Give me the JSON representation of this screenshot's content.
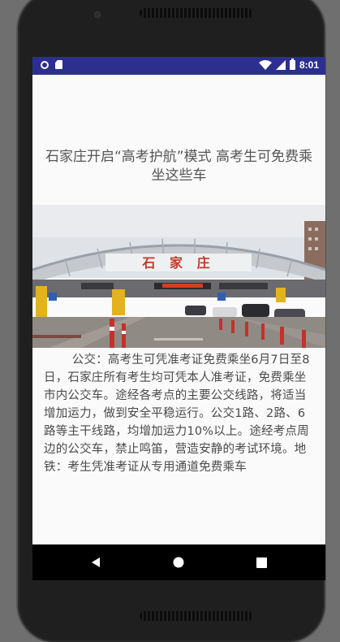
{
  "status_bar": {
    "time": "8:01",
    "icons": [
      "ring-icon",
      "sd-card-icon",
      "wifi-icon",
      "signal-icon",
      "battery-icon"
    ]
  },
  "article": {
    "title": "石家庄开启“高考护航”模式 高考生可免费乘坐这些车",
    "image": {
      "icon": "toll-gate-photo",
      "sign_text": "石 家 庄",
      "colors": {
        "sky": "#d9dde3",
        "canopy": "#bfc3c8",
        "road": "#8f8a85",
        "sign_red": "#c63a2a"
      }
    },
    "body": "公交：高考生可凭准考证免费乘坐6月7日至8日，石家庄所有考生均可凭本人准考证，免费乘坐市内公交车。途经各考点的主要公交线路，将适当增加运力，做到安全平稳运行。公交1路、2路、6路等主干线路，均增加运力10%以上。途经考点周边的公交车，禁止鸣笛，营造安静的考试环境。地铁：考生凭准考证从专用通道免费乘车"
  },
  "nav_bar": {
    "buttons": [
      "back-icon",
      "home-icon",
      "recents-icon"
    ]
  },
  "theme": {
    "status_bar_color": "#2d2f8f",
    "screen_bg": "#fafafa",
    "text_color": "#555555"
  }
}
